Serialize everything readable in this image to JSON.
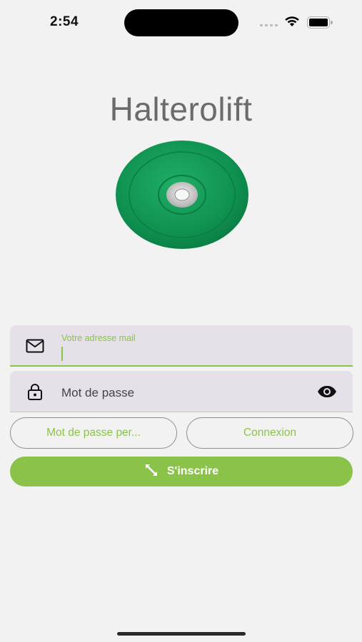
{
  "status_bar": {
    "time": "2:54"
  },
  "app": {
    "title": "Halterolift"
  },
  "form": {
    "email": {
      "label": "Votre adresse mail",
      "value": ""
    },
    "password": {
      "placeholder": "Mot de passe"
    }
  },
  "buttons": {
    "forgot_password": "Mot de passe per...",
    "login": "Connexion",
    "signup": "S'inscrire"
  },
  "colors": {
    "accent": "#8bc34a",
    "field_background": "#e6e1e9",
    "plate": "#12a05a"
  },
  "icons": {
    "email": "mail-icon",
    "password": "lock-icon",
    "visibility": "eye-icon",
    "signup": "expand-arrows-icon"
  }
}
